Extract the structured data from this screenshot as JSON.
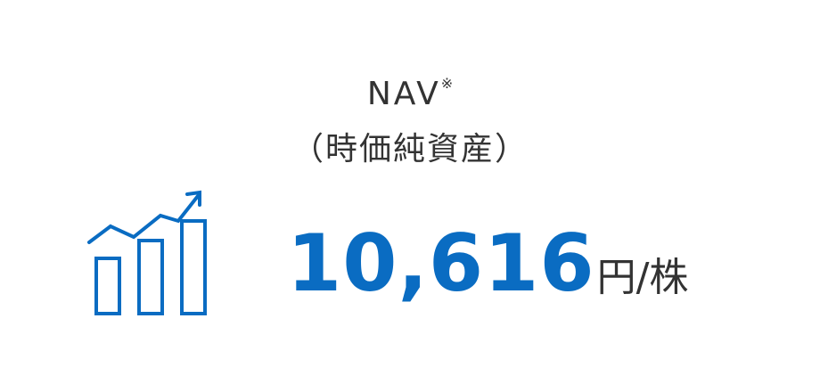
{
  "metric": {
    "title": "NAV",
    "note_mark": "※",
    "subtitle": "（時価純資産）",
    "value": "10,616",
    "unit": "円/株"
  },
  "icon": {
    "name": "bar-growth-chart-icon",
    "color": "#0a6cc2"
  },
  "colors": {
    "accent": "#0a6cc2",
    "text": "#333333",
    "background": "#ffffff"
  }
}
